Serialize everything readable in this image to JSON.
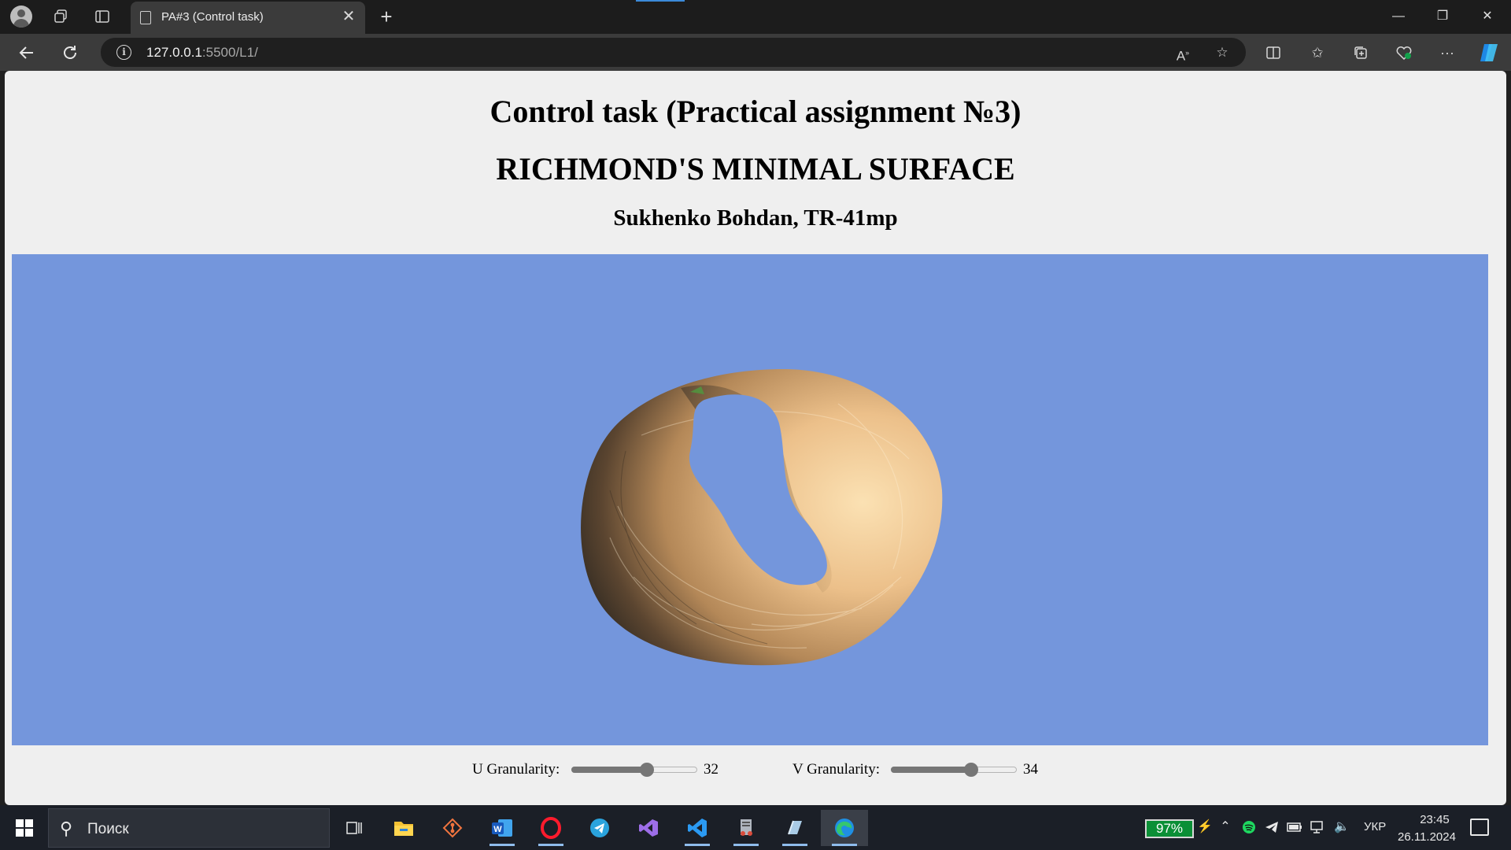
{
  "browser": {
    "tab_title": "PA#3 (Control task)",
    "tab_close": "✕",
    "new_tab": "+",
    "url_host": "127.0.0.1",
    "url_path": ":5500/L1/",
    "window_controls": {
      "minimize": "—",
      "restore": "❐",
      "close": "✕"
    }
  },
  "page": {
    "heading": "Control task (Practical assignment №3)",
    "subheading": "RICHMOND'S MINIMAL SURFACE",
    "author": "Sukhenko Bohdan, TR-41mp",
    "canvas_background": "#7496dc",
    "controls": {
      "u_label": "U Granularity:",
      "u_value": "32",
      "u_fraction": 0.6,
      "v_label": "V Granularity:",
      "v_value": "34",
      "v_fraction": 0.64
    }
  },
  "taskbar": {
    "search_placeholder": "Поиск",
    "battery": "97%",
    "language": "УКР",
    "time": "23:45",
    "date": "26.11.2024",
    "apps": [
      "task-view",
      "file-explorer",
      "git-app",
      "word",
      "opera",
      "telegram",
      "visual-studio",
      "vscode",
      "server-app",
      "notes-app",
      "edge"
    ]
  },
  "colors": {
    "accent": "#3b8ad9",
    "battery": "#0b8f36",
    "surface_light": "#f2cf9c",
    "surface_dark": "#2f2a22"
  }
}
